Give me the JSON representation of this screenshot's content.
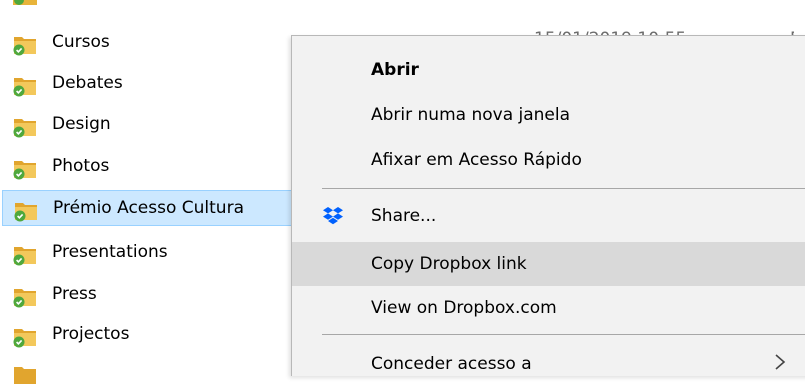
{
  "files": [
    {
      "name": "Cursos",
      "selected": false
    },
    {
      "name": "Debates",
      "selected": false
    },
    {
      "name": "Design",
      "selected": false
    },
    {
      "name": "Photos",
      "selected": false
    },
    {
      "name": "Prémio Acesso Cultura",
      "selected": true
    },
    {
      "name": "Presentations",
      "selected": false
    },
    {
      "name": "Press",
      "selected": false
    },
    {
      "name": "Projectos",
      "selected": false
    }
  ],
  "details": {
    "date_modified": "15/01/2019 10:55",
    "type_cut": "P"
  },
  "context_menu": {
    "items": [
      {
        "label": "Abrir",
        "bold": true
      },
      {
        "label": "Abrir numa nova janela"
      },
      {
        "label": "Afixar em Acesso Rápido"
      },
      {
        "label": "Share...",
        "icon": "dropbox-icon"
      },
      {
        "label": "Copy Dropbox link",
        "hovered": true
      },
      {
        "label": "View on Dropbox.com"
      },
      {
        "label": "Conceder acesso a",
        "submenu": true
      }
    ]
  },
  "colors": {
    "folder": "#e8b43a",
    "sync_check": "#4fa83d",
    "dropbox": "#0061fe",
    "selection": "#cce8ff",
    "menu_bg": "#f2f2f2",
    "menu_hover": "#d9d9d9"
  }
}
